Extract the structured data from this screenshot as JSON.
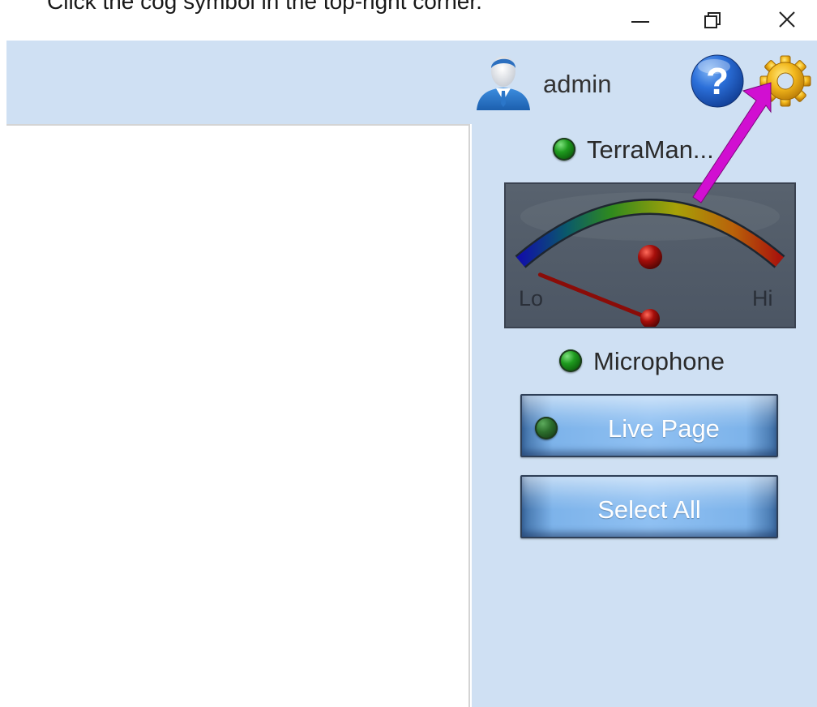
{
  "instruction": "Click the cog symbol in the top-right corner.",
  "window_controls": {
    "minimize_icon": "minimize-icon",
    "restore_icon": "restore-icon",
    "close_icon": "close-icon"
  },
  "header": {
    "user_name": "admin",
    "help_icon": "help-icon",
    "settings_icon": "gear-icon"
  },
  "side_panel": {
    "device_name": "TerraMan...",
    "device_status": "online",
    "meter": {
      "low_label": "Lo",
      "high_label": "Hi",
      "level": 0.0
    },
    "microphone_label": "Microphone",
    "microphone_status": "online",
    "live_page_button": "Live Page",
    "select_all_button": "Select All"
  },
  "colors": {
    "header_bg": "#cfe0f3",
    "annotation_arrow": "#d10fd1",
    "led_green": "#1e9a1e",
    "button_blue": "#7db3ea"
  }
}
